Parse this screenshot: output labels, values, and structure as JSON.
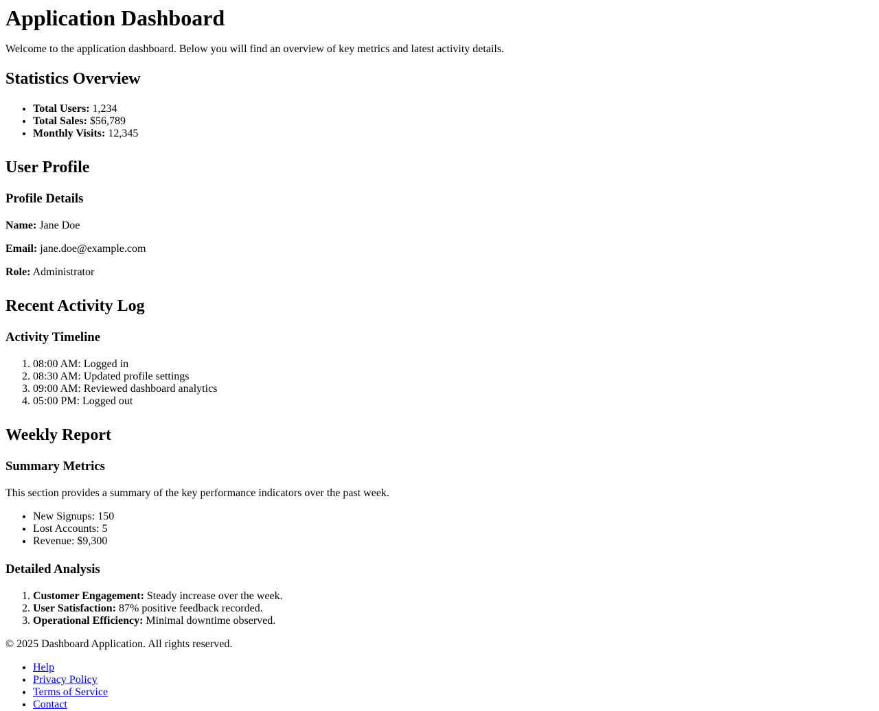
{
  "header": {
    "title": "Application Dashboard",
    "intro": "Welcome to the application dashboard. Below you will find an overview of key metrics and latest activity details."
  },
  "stats": {
    "heading": "Statistics Overview",
    "items": [
      {
        "label": "Total Users:",
        "value": "1,234"
      },
      {
        "label": "Total Sales:",
        "value": "$56,789"
      },
      {
        "label": "Monthly Visits:",
        "value": "12,345"
      }
    ]
  },
  "profile": {
    "heading": "User Profile",
    "subheading": "Profile Details",
    "name_label": "Name:",
    "name_value": "Jane Doe",
    "email_label": "Email:",
    "email_value": "jane.doe@example.com",
    "role_label": "Role:",
    "role_value": "Administrator"
  },
  "activity": {
    "heading": "Recent Activity Log",
    "subheading": "Activity Timeline",
    "items": [
      "08:00 AM: Logged in",
      "08:30 AM: Updated profile settings",
      "09:00 AM: Reviewed dashboard analytics",
      "05:00 PM: Logged out"
    ]
  },
  "weekly": {
    "heading": "Weekly Report",
    "summary_heading": "Summary Metrics",
    "summary_text": "This section provides a summary of the key performance indicators over the past week.",
    "summary_items": [
      "New Signups: 150",
      "Lost Accounts: 5",
      "Revenue: $9,300"
    ],
    "analysis_heading": "Detailed Analysis",
    "analysis_items": [
      {
        "label": "Customer Engagement:",
        "value": "Steady increase over the week."
      },
      {
        "label": "User Satisfaction:",
        "value": "87% positive feedback recorded."
      },
      {
        "label": "Operational Efficiency:",
        "value": "Minimal downtime observed."
      }
    ]
  },
  "footer": {
    "copyright": "© 2025 Dashboard Application. All rights reserved.",
    "links": [
      "Help",
      "Privacy Policy",
      "Terms of Service",
      "Contact"
    ]
  },
  "colors": {
    "text": "#000000",
    "link": "#0000ee",
    "background": "#ffffff"
  }
}
